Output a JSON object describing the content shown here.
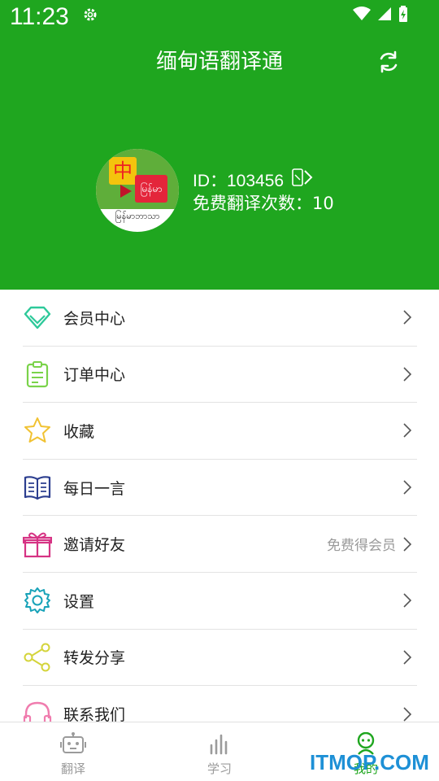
{
  "status_bar": {
    "time": "11:23"
  },
  "header": {
    "title": "缅甸语翻译通",
    "user_id": "ID：103456",
    "free_count": "免费翻译次数：10",
    "avatar": {
      "top_left_char": "中",
      "top_right_text": "မြန်မာ",
      "caption": "မြန်မာဘာသာ"
    }
  },
  "menu": [
    {
      "label": "会员中心",
      "icon": "diamond-icon",
      "extra": ""
    },
    {
      "label": "订单中心",
      "icon": "clipboard-icon",
      "extra": ""
    },
    {
      "label": "收藏",
      "icon": "star-icon",
      "extra": ""
    },
    {
      "label": "每日一言",
      "icon": "book-icon",
      "extra": ""
    },
    {
      "label": "邀请好友",
      "icon": "gift-icon",
      "extra": "免费得会员"
    },
    {
      "label": "设置",
      "icon": "gear-icon",
      "extra": ""
    },
    {
      "label": "转发分享",
      "icon": "share-icon",
      "extra": ""
    },
    {
      "label": "联系我们",
      "icon": "headset-icon",
      "extra": ""
    }
  ],
  "bottom_nav": [
    {
      "label": "翻译",
      "icon": "robot-icon",
      "active": false
    },
    {
      "label": "学习",
      "icon": "bars-icon",
      "active": false
    },
    {
      "label": "我的",
      "icon": "person-icon",
      "active": true
    }
  ],
  "watermark": "ITMOP.COM",
  "colors": {
    "brand_green": "#1fa61f",
    "divider": "#e3e3e3",
    "inactive_nav": "#9b9b9b"
  }
}
